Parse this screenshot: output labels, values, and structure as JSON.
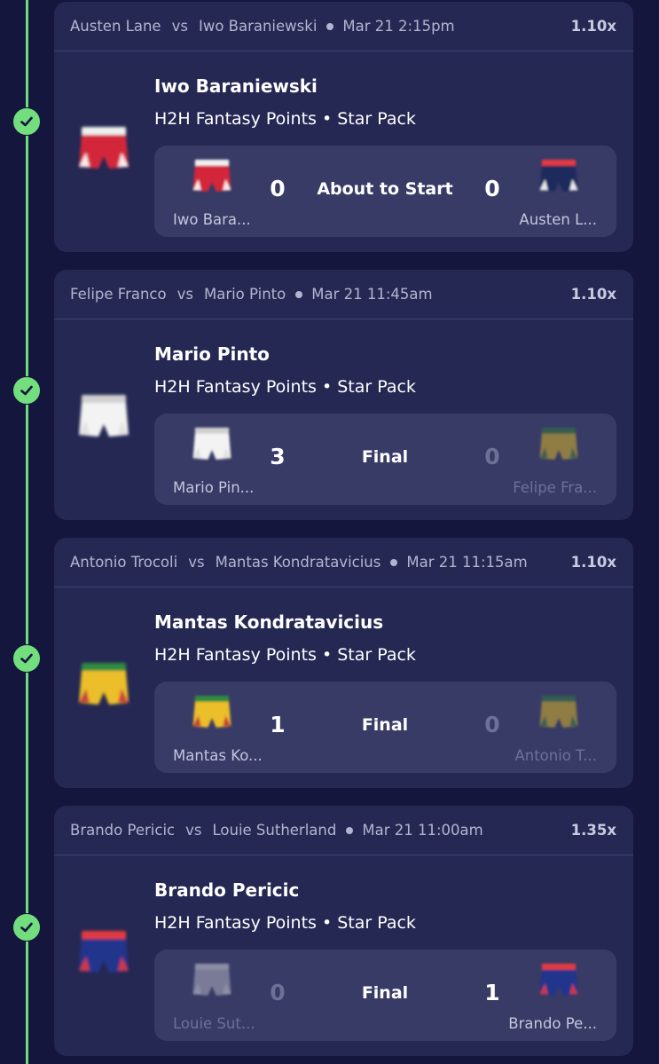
{
  "picks": [
    {
      "matchup": {
        "left_player": "Austen Lane",
        "vs_text": "vs",
        "right_player": "Iwo Baraniewski",
        "datetime": "Mar 21 2:15pm",
        "multiplier": "1.10x"
      },
      "pick_name": "Iwo Baraniewski",
      "pick_type": "H2H Fantasy Points • Star Pack",
      "pick_shorts_color": "red",
      "left": {
        "name": "Iwo Bara...",
        "score": "0",
        "shorts_color": "red",
        "dimmed": false
      },
      "status": "About to Start",
      "right": {
        "name": "Austen L...",
        "score": "0",
        "shorts_color": "navy",
        "dimmed": false
      },
      "status_icon": "check-icon"
    },
    {
      "matchup": {
        "left_player": "Felipe Franco",
        "vs_text": "vs",
        "right_player": "Mario Pinto",
        "datetime": "Mar 21 11:45am",
        "multiplier": "1.10x"
      },
      "pick_name": "Mario Pinto",
      "pick_type": "H2H Fantasy Points • Star Pack",
      "pick_shorts_color": "white",
      "left": {
        "name": "Mario Pin...",
        "score": "3",
        "shorts_color": "white",
        "dimmed": false
      },
      "status": "Final",
      "right": {
        "name": "Felipe Fra...",
        "score": "0",
        "shorts_color": "yellow",
        "dimmed": true
      },
      "status_icon": "check-icon"
    },
    {
      "matchup": {
        "left_player": "Antonio Trocoli",
        "vs_text": "vs",
        "right_player": "Mantas Kondratavicius",
        "datetime": "Mar 21 11:15am",
        "multiplier": "1.10x"
      },
      "pick_name": "Mantas Kondratavicius",
      "pick_type": "H2H Fantasy Points • Star Pack",
      "pick_shorts_color": "yellow-red",
      "left": {
        "name": "Mantas Ko...",
        "score": "1",
        "shorts_color": "yellow-red",
        "dimmed": false
      },
      "status": "Final",
      "right": {
        "name": "Antonio T...",
        "score": "0",
        "shorts_color": "yellow",
        "dimmed": true
      },
      "status_icon": "check-icon"
    },
    {
      "matchup": {
        "left_player": "Brando Pericic",
        "vs_text": "vs",
        "right_player": "Louie Sutherland",
        "datetime": "Mar 21 11:00am",
        "multiplier": "1.35x"
      },
      "pick_name": "Brando Pericic",
      "pick_type": "H2H Fantasy Points • Star Pack",
      "pick_shorts_color": "blue-red",
      "left": {
        "name": "Louie Sut...",
        "score": "0",
        "shorts_color": "grey",
        "dimmed": true
      },
      "status": "Final",
      "right": {
        "name": "Brando Pe...",
        "score": "1",
        "shorts_color": "blue-red",
        "dimmed": false
      },
      "status_icon": "check-icon"
    }
  ],
  "colors": {
    "background": "#14163d",
    "card": "#252853",
    "inner_card": "#383b66",
    "timeline": "#6fdc7c",
    "dimmed_text": "#6d7097"
  },
  "shorts_palettes": {
    "red": {
      "top": "#f0f0f0",
      "body": "#d3283a",
      "trim": "#ffffff"
    },
    "navy": {
      "top": "#e33a45",
      "body": "#1d2b5c",
      "trim": "#ffffff"
    },
    "white": {
      "top": "#d0d0d0",
      "body": "#f3f3f3",
      "trim": "#e0e0e0"
    },
    "yellow": {
      "top": "#2d7a3e",
      "body": "#d6b42c",
      "trim": "#2d7a3e"
    },
    "yellow-red": {
      "top": "#2f8a3f",
      "body": "#ebbe2b",
      "trim": "#c8323a"
    },
    "blue-red": {
      "top": "#e23a3f",
      "body": "#22348c",
      "trim": "#e23a3f"
    },
    "grey": {
      "top": "#cfcfd8",
      "body": "#b0b2c0",
      "trim": "#d8d8e0"
    }
  }
}
